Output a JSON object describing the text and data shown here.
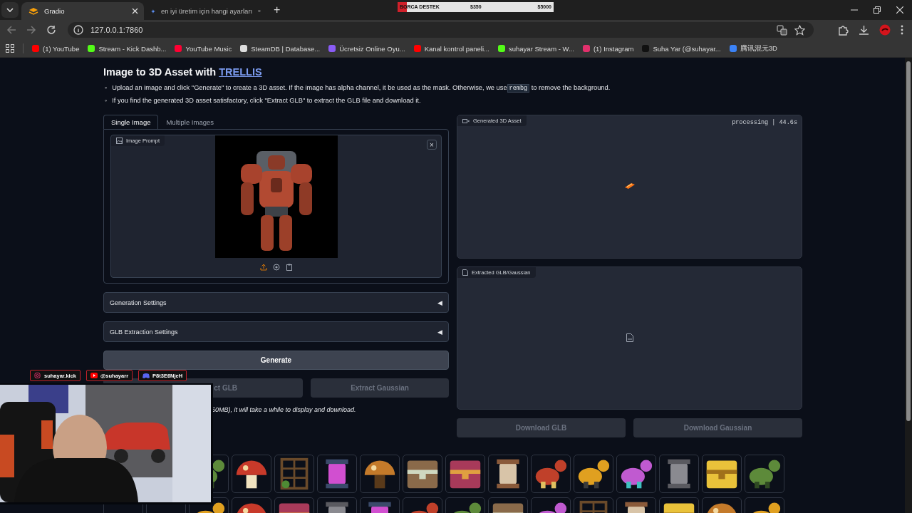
{
  "browser": {
    "tabs": [
      {
        "title": "Gradio",
        "selected": true
      },
      {
        "title": "en iyi üretim için hangi ayarları",
        "selected": false
      }
    ],
    "new_tab": "+",
    "address": "127.0.0.1:7860",
    "bookmarks": [
      {
        "label": "(1) YouTube",
        "color": "#ff0000"
      },
      {
        "label": "Stream - Kick Dashb...",
        "color": "#53fc18"
      },
      {
        "label": "YouTube Music",
        "color": "#ff0033"
      },
      {
        "label": "SteamDB | Database...",
        "color": "#dddddd"
      },
      {
        "label": "Ücretsiz Online Oyu...",
        "color": "#8a5cf6"
      },
      {
        "label": "Kanal kontrol paneli...",
        "color": "#ff0000"
      },
      {
        "label": "suhayar Stream - W...",
        "color": "#53fc18"
      },
      {
        "label": "(1) Instagram",
        "color": "#e1306c"
      },
      {
        "label": "Suha Yar (@suhayar...",
        "color": "#111111"
      },
      {
        "label": "腾讯混元3D",
        "color": "#3b82f6"
      }
    ]
  },
  "donation": {
    "label": "BORCA DESTEK",
    "current": "$350",
    "goal": "$5000",
    "level": 0.06
  },
  "app": {
    "title": "Image to 3D Asset with",
    "title_link": "TRELLIS",
    "bullets": [
      {
        "marker": "◦",
        "before": "Upload an image and click \"Generate\" to create a 3D asset. If the image has alpha channel, it be used as the mask. Otherwise, we use",
        "code": "rembg",
        "after": "to remove the background."
      },
      {
        "marker": "◦",
        "before": "If you find the generated 3D asset satisfactory, click \"Extract GLB\" to extract the GLB file and download it."
      }
    ],
    "input_tabs": [
      {
        "label": "Single Image",
        "selected": true
      },
      {
        "label": "Multiple Images",
        "selected": false
      }
    ],
    "image_prompt": {
      "label": "Image Prompt",
      "close": "×"
    },
    "accordions": [
      {
        "label": "Generation Settings",
        "arrow": "◀",
        "expanded": false
      },
      {
        "label": "GLB Extraction Settings",
        "arrow": "◀",
        "expanded": false
      }
    ],
    "generate": {
      "label": "Generate",
      "disabled": false
    },
    "extract_buttons": [
      {
        "label": "ct GLB",
        "disabled": true
      },
      {
        "label": "Extract Gaussian",
        "disabled": true
      }
    ],
    "note": "50MB), it will take a while to display and download.",
    "generated": {
      "label": "Generated 3D Asset",
      "status": "processing | 44.6s"
    },
    "extracted": {
      "label": "Extracted GLB/Gaussian"
    },
    "download_buttons": [
      {
        "label": "Download GLB",
        "disabled": true
      },
      {
        "label": "Download Gaussian",
        "disabled": true
      }
    ]
  },
  "overlay": {
    "socials": [
      {
        "kind": "instagram",
        "handle": "suhayar.kick"
      },
      {
        "kind": "youtube",
        "handle": "@suhayarr"
      },
      {
        "kind": "discord",
        "handle": "P8t3E6NjeH"
      }
    ]
  }
}
